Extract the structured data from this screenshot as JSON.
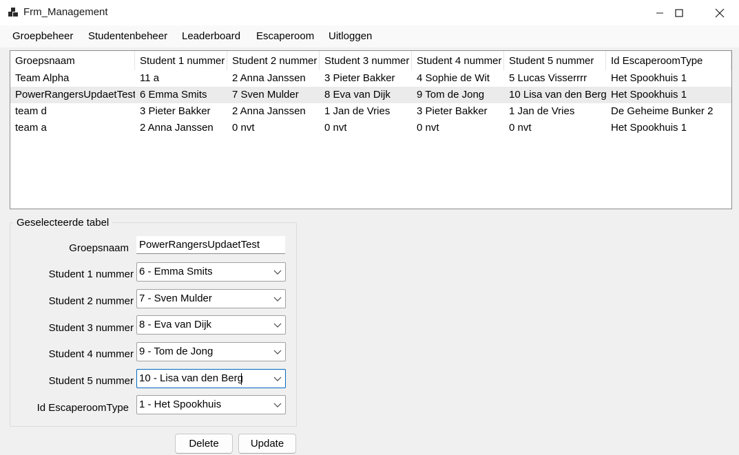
{
  "window": {
    "title": "Frm_Management"
  },
  "menu": {
    "items": [
      "Groepbeheer",
      "Studentenbeheer",
      "Leaderboard",
      "Escaperoom",
      "Uitloggen"
    ]
  },
  "table": {
    "columns": [
      "Groepsnaam",
      "Student 1 nummer",
      "Student 2 nummer",
      "Student 3 nummer",
      "Student 4 nummer",
      "Student 5 nummer",
      "Id EscaperoomType"
    ],
    "rows": [
      [
        "Team Alpha",
        "11 a",
        "2 Anna Janssen",
        "3 Pieter Bakker",
        "4 Sophie de Wit",
        "5 Lucas Visserrrr",
        "Het Spookhuis 1"
      ],
      [
        "PowerRangersUpdaetTest",
        "6 Emma Smits",
        "7 Sven Mulder",
        "8 Eva van Dijk",
        "9 Tom de Jong",
        "10 Lisa van den Berg",
        "Het Spookhuis 1"
      ],
      [
        "team d",
        "3 Pieter Bakker",
        "2 Anna Janssen",
        "1 Jan de Vries",
        "3 Pieter Bakker",
        "1 Jan de Vries",
        "De Geheime Bunker 2"
      ],
      [
        "team a",
        "2 Anna Janssen",
        "0 nvt",
        "0 nvt",
        "0 nvt",
        "0 nvt",
        "Het Spookhuis 1"
      ]
    ],
    "selected_row": 1
  },
  "form": {
    "legend": "Geselecteerde tabel",
    "groepsnaam_label": "Groepsnaam",
    "groepsnaam_value": "PowerRangersUpdaetTest",
    "student1_label": "Student 1 nummer",
    "student1_value": "6 - Emma Smits",
    "student2_label": "Student 2 nummer",
    "student2_value": "7 - Sven Mulder",
    "student3_label": "Student 3 nummer",
    "student3_value": "8 - Eva van Dijk",
    "student4_label": "Student 4 nummer",
    "student4_value": "9 - Tom de Jong",
    "student5_label": "Student 5 nummer",
    "student5_value": "10 - Lisa van den Berg",
    "escaperoom_label": "Id EscaperoomType",
    "escaperoom_value": "1 - Het Spookhuis"
  },
  "buttons": {
    "delete": "Delete",
    "update": "Update"
  },
  "colors": {
    "selected_row": "#ebebeb",
    "focus_border": "#0067c0"
  }
}
